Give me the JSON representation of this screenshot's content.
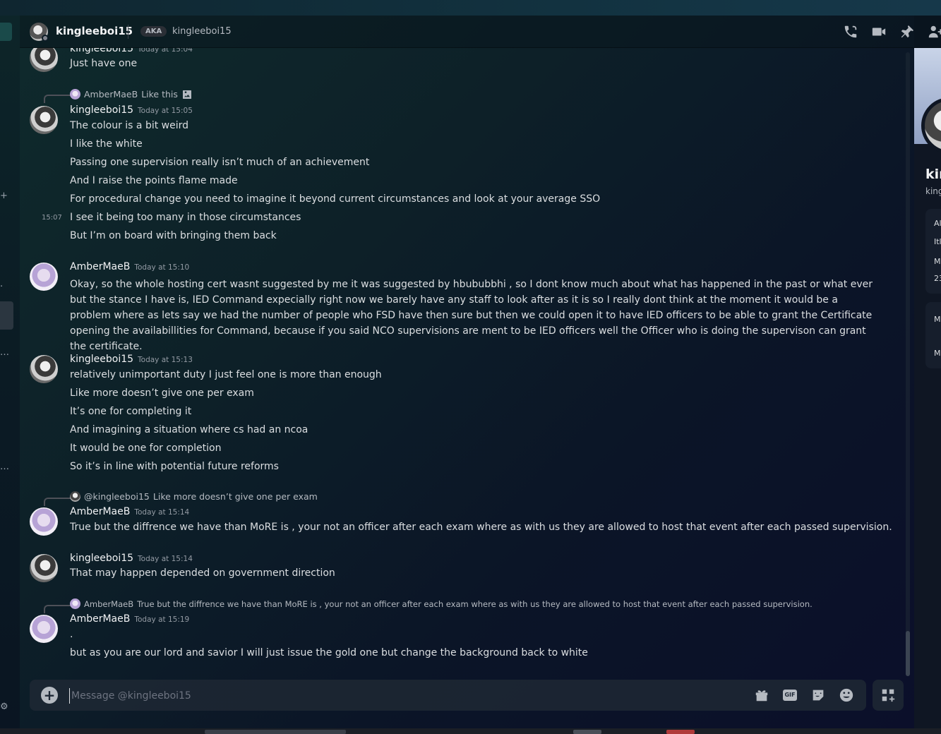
{
  "header": {
    "username": "kingleeboi15",
    "aka_label": "AKA",
    "alias": "kingleeboi15",
    "icons": [
      "phone-call-icon",
      "video-call-icon",
      "pin-icon",
      "add-friends-icon"
    ]
  },
  "messages": [
    {
      "author": "kingleeboi15",
      "timestamp": "Today at 15:04",
      "lines": [
        "Just have one"
      ]
    },
    {
      "reply": {
        "author": "AmberMaeB",
        "text": "Like this",
        "has_image": true
      },
      "author": "kingleeboi15",
      "timestamp": "Today at 15:05",
      "lines": [
        "The colour is a bit weird",
        "I like the white",
        "Passing one supervision really isn’t much of an achievement",
        "And I raise the points flame made",
        "For procedural change you need to imagine it beyond current circumstances and look at your average SSO",
        "I see it being too many in those circumstances",
        "But I’m on board with bringing them back"
      ],
      "hover_time": "15:07"
    },
    {
      "author": "AmberMaeB",
      "timestamp": "Today at 15:10",
      "lines": [
        "Okay, so the whole hosting cert wasnt suggested by me it was suggested by hbububbhi , so I dont know much about what has happened in the past or what ever but the stance I have is, IED Command expecially right now we barely have any staff to look after as it is so I really dont think at the moment it would be a problem where as lets say we had the number of people who FSD have then sure but then we could open it to have IED officers to be able to grant the Certificate opening the availabillities for Command, because if you said NCO supervisions are ment to be IED officers well the Officer who is doing the supervison can grant the certificate."
      ]
    },
    {
      "author": "kingleeboi15",
      "timestamp": "Today at 15:13",
      "lines": [
        "relatively unimportant duty I just feel one is more than enough",
        "Like more doesn’t give one per exam",
        "It’s one for completing it",
        "And imagining a situation where cs had an ncoa",
        "It would be one for completion",
        "So it’s in line with potential future reforms"
      ]
    },
    {
      "reply": {
        "author": "@kingleeboi15",
        "text": "Like more doesn’t give one per exam",
        "has_image": false
      },
      "author": "AmberMaeB",
      "timestamp": "Today at 15:14",
      "lines": [
        "True but the diffrence we have than MoRE is , your not an officer after each exam where as with us they are allowed to host that event after each passed supervision."
      ]
    },
    {
      "author": "kingleeboi15",
      "timestamp": "Today at 15:14",
      "lines": [
        "That may happen depended on government direction"
      ]
    },
    {
      "reply": {
        "author": "AmberMaeB",
        "text": "True but the diffrence we have than MoRE is , your not an officer after each exam where as with us they are allowed to host that event after each passed supervision.",
        "has_image": false
      },
      "author": "AmberMaeB",
      "timestamp": "Today at 15:19",
      "lines": [
        ".",
        "but as you are our lord and savior I will just issue the gold one but change the background back to white"
      ]
    }
  ],
  "composer": {
    "placeholder": "Message @kingleeboi15",
    "gif_label": "GIF",
    "icons": [
      "gift-icon",
      "gif-icon",
      "sticker-icon",
      "emoji-icon",
      "apps-icon"
    ]
  },
  "profile_panel": {
    "name_partial": "kin",
    "handle_partial": "king",
    "fragments": [
      "Al",
      "Itl",
      "M",
      "23",
      "M",
      "M"
    ]
  },
  "colors": {
    "text_primary": "#f2f3f5",
    "text_body": "#dbdee1",
    "text_muted": "#949ba4",
    "status_offline": "#80848e"
  }
}
